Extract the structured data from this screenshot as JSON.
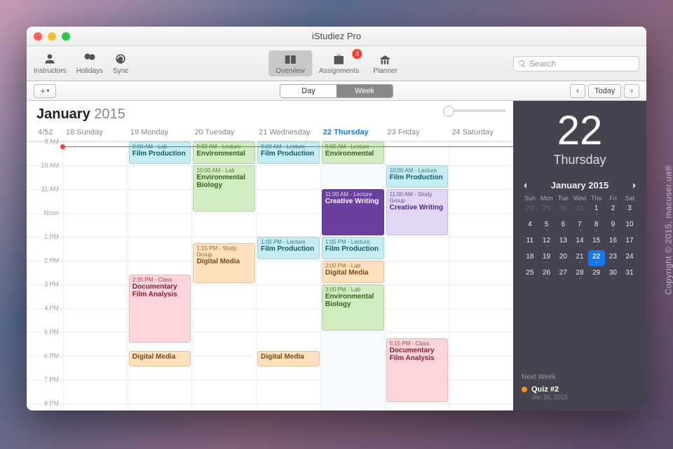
{
  "window": {
    "title": "iStudiez Pro"
  },
  "toolbar": {
    "instructors": "Instructors",
    "holidays": "Holidays",
    "sync": "Sync",
    "overview": "Overview",
    "assignments": "Assignments",
    "assign_badge": "3",
    "planner": "Planner",
    "search_ph": "Search"
  },
  "subbar": {
    "day": "Day",
    "week": "Week",
    "today": "Today"
  },
  "header": {
    "month": "January",
    "year": "2015",
    "week": "4/52"
  },
  "days": [
    {
      "label": "18 Sunday",
      "today": false
    },
    {
      "label": "19 Monday",
      "today": false
    },
    {
      "label": "20 Tuesday",
      "today": false
    },
    {
      "label": "21 Wednesday",
      "today": false
    },
    {
      "label": "22 Thursday",
      "today": true
    },
    {
      "label": "23 Friday",
      "today": false
    },
    {
      "label": "24 Saturday",
      "today": false
    }
  ],
  "hours": [
    "9 AM",
    "10 AM",
    "11 AM",
    "Noon",
    "1 PM",
    "2 PM",
    "3 PM",
    "4 PM",
    "5 PM",
    "6 PM",
    "7 PM",
    "8 PM"
  ],
  "events": [
    {
      "day": 1,
      "start": 9,
      "end": 10,
      "time": "9:00 AM - Lab",
      "title": "Film Production",
      "color": "c-teal"
    },
    {
      "day": 1,
      "start": 14.583,
      "end": 17.5,
      "time": "2:35 PM - Class",
      "title": "Documentary Film Analysis",
      "color": "c-pink"
    },
    {
      "day": 1,
      "start": 17.8,
      "end": 18.5,
      "time": "",
      "title": "Digital Media",
      "color": "c-orange"
    },
    {
      "day": 2,
      "start": 9,
      "end": 10,
      "time": "9:00 AM - Lecture",
      "title": "Environmental",
      "color": "c-green"
    },
    {
      "day": 2,
      "start": 10,
      "end": 12,
      "time": "10:00 AM - Lab",
      "title": "Environmental Biology",
      "color": "c-green"
    },
    {
      "day": 2,
      "start": 13.25,
      "end": 15,
      "time": "1:15 PM - Study Group",
      "title": "Digital Media",
      "color": "c-orange"
    },
    {
      "day": 3,
      "start": 9,
      "end": 10,
      "time": "9:00 AM - Lecture",
      "title": "Film Production",
      "color": "c-teal"
    },
    {
      "day": 3,
      "start": 13,
      "end": 14,
      "time": "1:00 PM - Lecture",
      "title": "Film Production",
      "color": "c-teal"
    },
    {
      "day": 3,
      "start": 17.8,
      "end": 18.5,
      "time": "",
      "title": "Digital Media",
      "color": "c-orange"
    },
    {
      "day": 4,
      "start": 9,
      "end": 10,
      "time": "9:00 AM - Lecture",
      "title": "Environmental",
      "color": "c-green"
    },
    {
      "day": 4,
      "start": 11,
      "end": 13,
      "time": "11:00 AM - Lecture",
      "title": "Creative Writing",
      "color": "c-darkpurple"
    },
    {
      "day": 4,
      "start": 13,
      "end": 14,
      "time": "1:00 PM - Lecture",
      "title": "Film Production",
      "color": "c-teal"
    },
    {
      "day": 4,
      "start": 14,
      "end": 15,
      "time": "2:00 PM - Lab",
      "title": "Digital Media",
      "color": "c-orange"
    },
    {
      "day": 4,
      "start": 15,
      "end": 17,
      "time": "3:00 PM - Lab",
      "title": "Environmental Biology",
      "color": "c-green"
    },
    {
      "day": 5,
      "start": 10,
      "end": 11,
      "time": "10:00 AM - Lecture",
      "title": "Film Production",
      "color": "c-teal"
    },
    {
      "day": 5,
      "start": 11,
      "end": 13,
      "time": "11:00 AM - Study Group",
      "title": "Creative Writing",
      "color": "c-purple"
    },
    {
      "day": 5,
      "start": 17.25,
      "end": 20,
      "time": "5:15 PM - Class",
      "title": "Documentary Film Analysis",
      "color": "c-pink"
    }
  ],
  "now": 9.2,
  "sidebar": {
    "bignum": "22",
    "bigday": "Thursday",
    "mini_title": "January 2015",
    "dow": [
      "Sun",
      "Mon",
      "Tue",
      "Wed",
      "Thu",
      "Fri",
      "Sat"
    ],
    "cells": [
      {
        "n": "28",
        "dim": true
      },
      {
        "n": "29",
        "dim": true
      },
      {
        "n": "30",
        "dim": true
      },
      {
        "n": "31",
        "dim": true
      },
      {
        "n": "1",
        "d": ".."
      },
      {
        "n": "2",
        "d": ".."
      },
      {
        "n": "3",
        "d": "."
      },
      {
        "n": "4"
      },
      {
        "n": "5",
        "d": "..."
      },
      {
        "n": "6",
        "d": ".."
      },
      {
        "n": "7",
        "d": "..."
      },
      {
        "n": "8",
        "d": "..."
      },
      {
        "n": "9",
        "d": ".."
      },
      {
        "n": "10"
      },
      {
        "n": "11"
      },
      {
        "n": "12",
        "d": "..."
      },
      {
        "n": "13",
        "d": ".."
      },
      {
        "n": "14",
        "d": "..."
      },
      {
        "n": "15",
        "d": "..."
      },
      {
        "n": "16",
        "d": ".."
      },
      {
        "n": "17"
      },
      {
        "n": "18"
      },
      {
        "n": "19",
        "d": "..."
      },
      {
        "n": "20",
        "d": ".."
      },
      {
        "n": "21",
        "d": "..."
      },
      {
        "n": "22",
        "today": true,
        "d": "..."
      },
      {
        "n": "23",
        "d": ".."
      },
      {
        "n": "24"
      },
      {
        "n": "25"
      },
      {
        "n": "26",
        "d": "..."
      },
      {
        "n": "27",
        "d": ".."
      },
      {
        "n": "28",
        "d": "..."
      },
      {
        "n": "29",
        "d": "..."
      },
      {
        "n": "30",
        "d": ".."
      },
      {
        "n": "31"
      }
    ],
    "next_label": "Next Week",
    "quiz": "Quiz #2",
    "quiz_date": "Jan 30, 2015"
  },
  "copyright": "Copyright © 2015, macuser.ua®"
}
